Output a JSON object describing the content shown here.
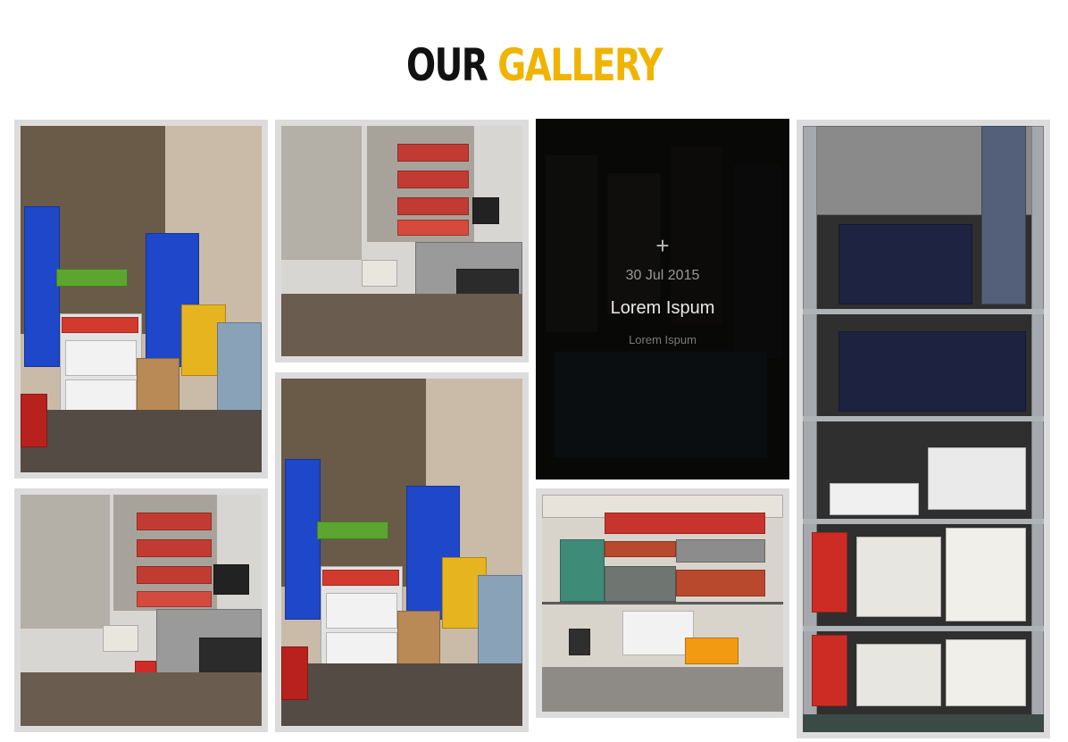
{
  "header": {
    "title_word1": "OUR",
    "title_word2": "GALLERY"
  },
  "colors": {
    "accent": "#f0b400",
    "dark": "#111111",
    "frame": "#dcdcdc"
  },
  "gallery": {
    "items": [
      {
        "name": "Hardware store shelves with heaters",
        "kind": "store-photo"
      },
      {
        "name": "Paint buckets aisle",
        "kind": "store-photo"
      },
      {
        "name": "Hovered gallery item",
        "kind": "store-photo",
        "hover": true,
        "icon": "plus-icon",
        "date": "30 Jul 2015",
        "title": "Lorem Ispum",
        "subtitle": "Lorem Ispum"
      },
      {
        "name": "Sanitary shelving",
        "kind": "store-photo"
      },
      {
        "name": "Paint buckets aisle 2",
        "kind": "store-photo"
      },
      {
        "name": "Hardware store shelves with heaters 2",
        "kind": "store-photo"
      },
      {
        "name": "Outdoor pipes display",
        "kind": "store-photo"
      }
    ]
  }
}
